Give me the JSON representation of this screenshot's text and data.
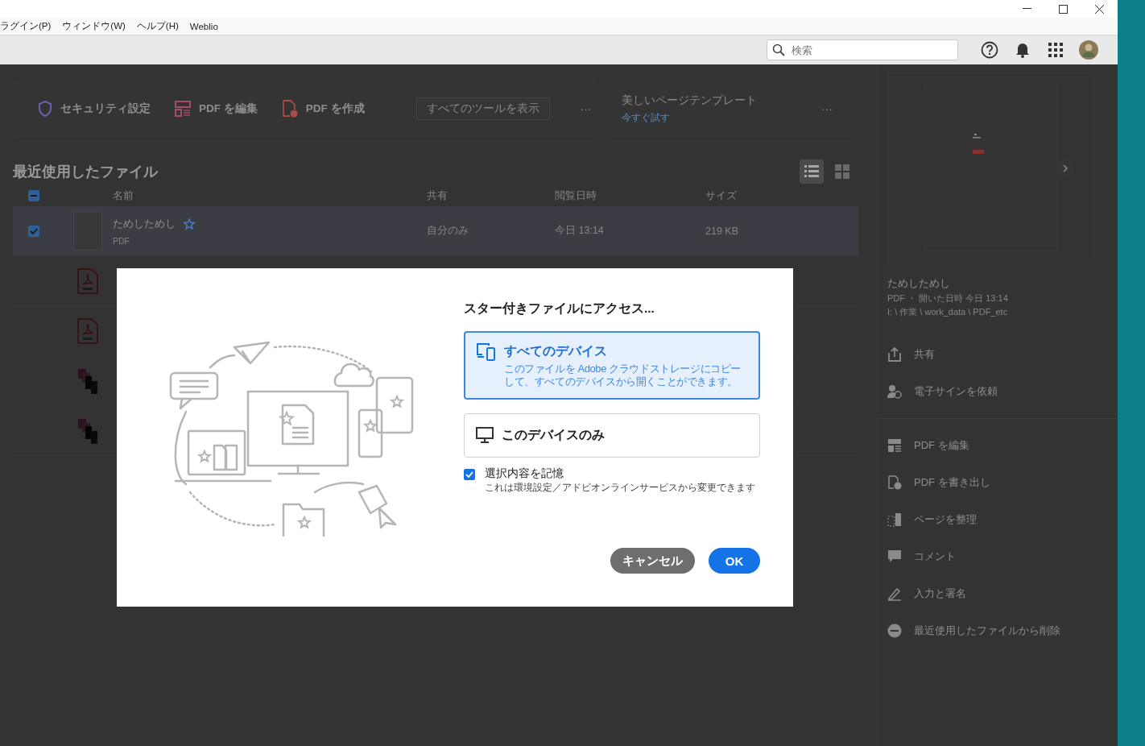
{
  "menu": [
    "ラグイン(P)",
    "ウィンドウ(W)",
    "ヘルプ(H)",
    "Weblio"
  ],
  "toolbar": {
    "search": {
      "placeholder": "検索"
    }
  },
  "tools": {
    "items": [
      {
        "label": "セキュリティ設定",
        "kind": "security"
      },
      {
        "label": "PDF を編集",
        "kind": "edit"
      },
      {
        "label": "PDF を作成",
        "kind": "create"
      }
    ],
    "all_tools": "すべてのツールを表示",
    "more": "···"
  },
  "promo": {
    "title": "美しいページテンプレート",
    "link": "今すぐ試す",
    "more": "···"
  },
  "recent": {
    "title": "最近使用したファイル",
    "views": [
      {
        "kind": "list",
        "selected": true
      },
      {
        "kind": "grid",
        "selected": false
      }
    ],
    "select_all": {
      "indeterminate": true
    },
    "columns": [
      "名前",
      "共有",
      "閲覧日時",
      "サイズ"
    ],
    "rows": [
      {
        "kind": "blank",
        "selected": true,
        "name": "ためしためし",
        "type": "PDF",
        "shared": "自分のみ",
        "viewed": "今日 13:14",
        "size": "219 KB"
      },
      {
        "kind": "pdf",
        "selected": false
      },
      {
        "kind": "pdf",
        "selected": false
      },
      {
        "kind": "stack",
        "selected": false
      },
      {
        "kind": "stack",
        "selected": false
      }
    ]
  },
  "details": {
    "name": "ためしためし",
    "meta": "PDF ・ 開いた日時 今日 13:14",
    "path": "I: \\ 作業 \\ work_data \\ PDF_etc",
    "groups": [
      [
        {
          "label": "共有",
          "kind": "share"
        },
        {
          "label": "電子サインを依頼",
          "kind": "sign-request"
        }
      ],
      [
        {
          "label": "PDF を編集",
          "kind": "edit"
        },
        {
          "label": "PDF を書き出し",
          "kind": "export"
        },
        {
          "label": "ページを整理",
          "kind": "organize"
        },
        {
          "label": "コメント",
          "kind": "comment"
        },
        {
          "label": "入力と署名",
          "kind": "fill-sign"
        },
        {
          "label": "最近使用したファイルから削除",
          "kind": "remove"
        }
      ]
    ]
  },
  "dialog": {
    "title": "スター付きファイルにアクセス...",
    "options": [
      {
        "kind": "devices",
        "selected": true,
        "title": "すべてのデバイス",
        "description": "このファイルを Adobe クラウドストレージにコピーして、すべてのデバイスから開くことができます。"
      },
      {
        "kind": "monitor",
        "selected": false,
        "title": "このデバイスのみ"
      }
    ],
    "remember": {
      "label": "選択内容を記憶",
      "note": "これは環境設定／アドビオンラインサービスから変更できます",
      "checked": true
    },
    "buttons": [
      {
        "label": "キャンセル",
        "kind": "secondary"
      },
      {
        "label": "OK",
        "kind": "primary"
      }
    ]
  }
}
